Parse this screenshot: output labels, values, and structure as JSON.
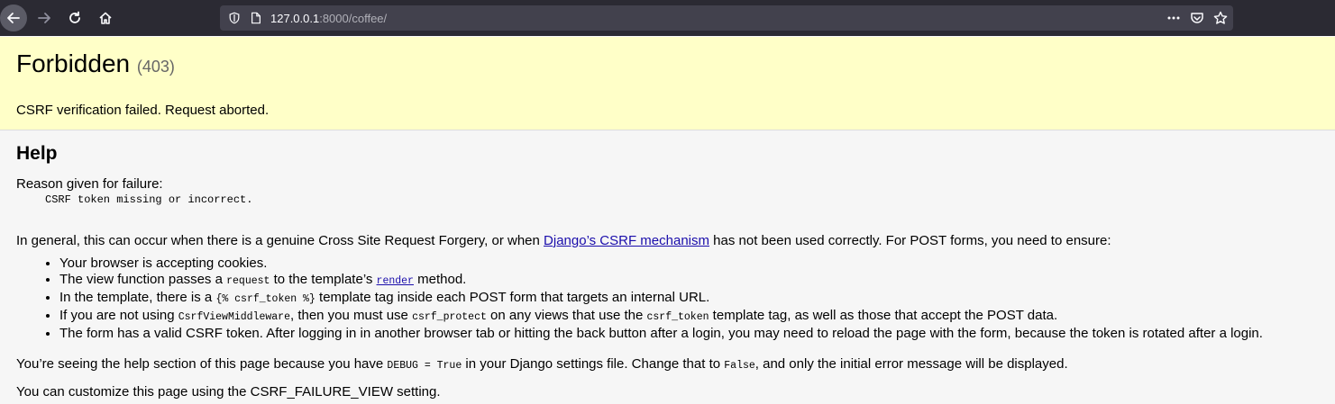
{
  "browser": {
    "url_host": "127.0.0.1",
    "url_rest": ":8000/coffee/"
  },
  "summary": {
    "title": "Forbidden",
    "status_code": "(403)",
    "message": "CSRF verification failed. Request aborted."
  },
  "help": {
    "heading": "Help",
    "reason_label": "Reason given for failure:",
    "reason_text": "CSRF token missing or incorrect.",
    "general_before": "In general, this can occur when there is a genuine Cross Site Request Forgery, or when ",
    "general_link": "Django’s CSRF mechanism",
    "general_after": " has not been used correctly. For POST forms, you need to ensure:",
    "items": [
      {
        "text": "Your browser is accepting cookies."
      },
      {
        "p1": "The view function passes a ",
        "code1": "request",
        "p2": " to the template’s ",
        "link": "render",
        "p3": " method."
      },
      {
        "p1": "In the template, there is a ",
        "code1": "{% csrf_token %}",
        "p2": " template tag inside each POST form that targets an internal URL."
      },
      {
        "p1": "If you are not using ",
        "code1": "CsrfViewMiddleware",
        "p2": ", then you must use ",
        "code2": "csrf_protect",
        "p3": " on any views that use the ",
        "code3": "csrf_token",
        "p4": " template tag, as well as those that accept the POST data."
      },
      {
        "text": "The form has a valid CSRF token. After logging in in another browser tab or hitting the back button after a login, you may need to reload the page with the form, because the token is rotated after a login."
      }
    ],
    "debug_p1": "You’re seeing the help section of this page because you have ",
    "debug_code1": "DEBUG = True",
    "debug_p2": " in your Django settings file. Change that to ",
    "debug_code2": "False",
    "debug_p3": ", and only the initial error message will be displayed.",
    "customize": "You can customize this page using the CSRF_FAILURE_VIEW setting."
  }
}
